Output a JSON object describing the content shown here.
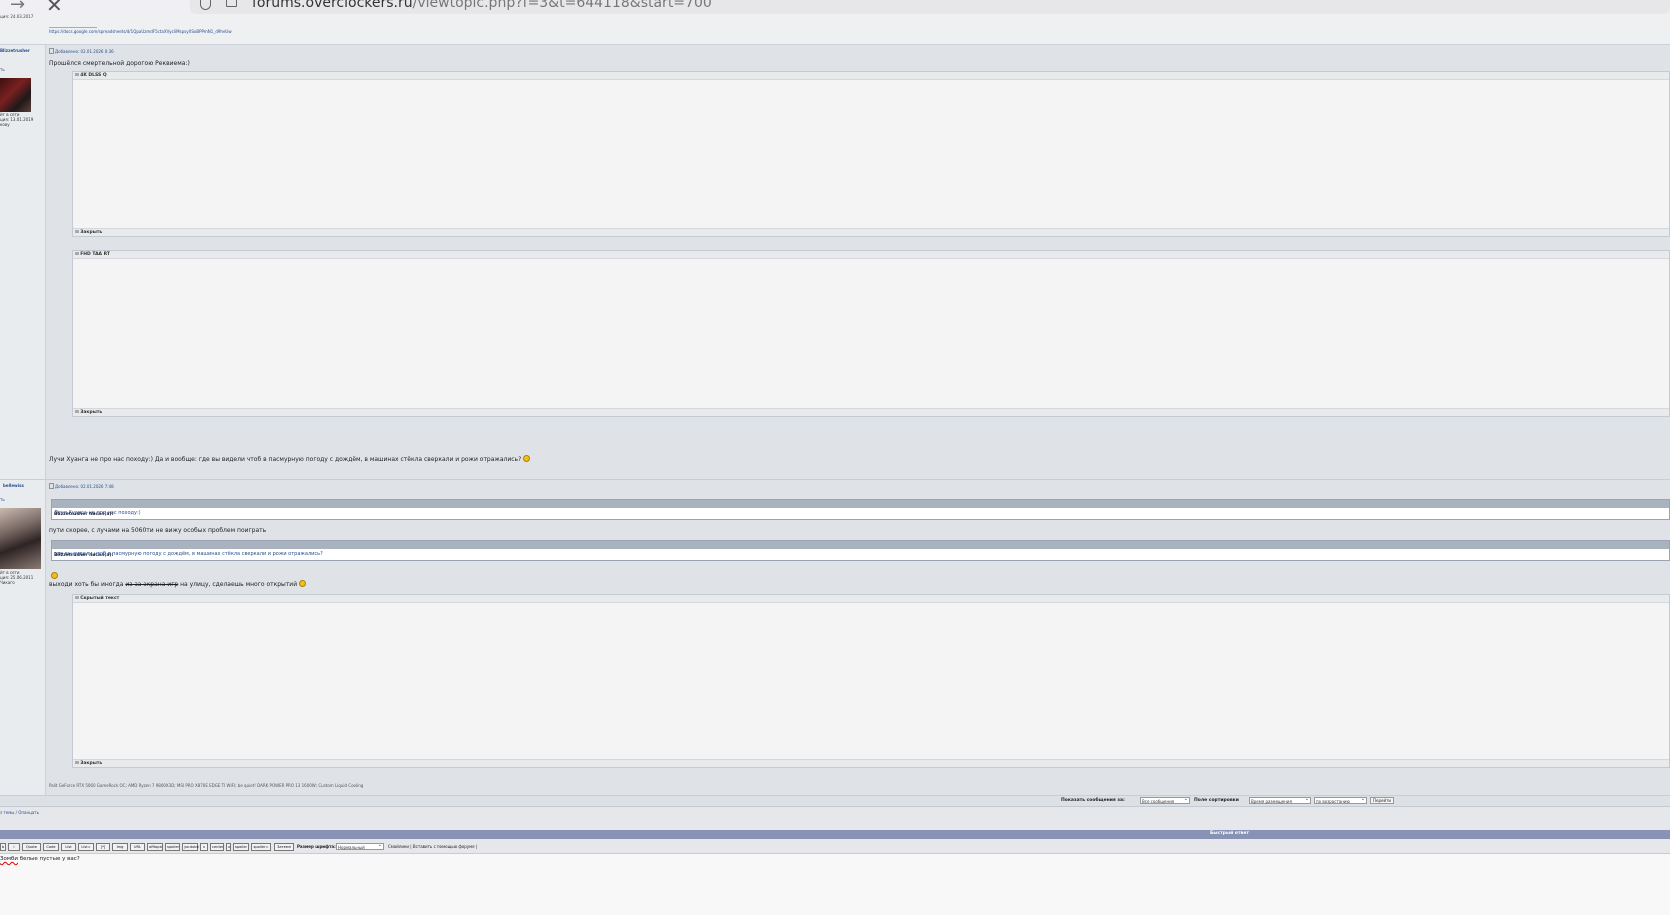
{
  "browser": {
    "url_domain": "forums.overclockers.ru",
    "url_path": "/viewtopic.php?f=3&t=644118&start=700"
  },
  "top": {
    "author_meta": "ция: 24.03.2017",
    "link": "https://docs.google.com/spreadsheets/d/1QpaUzmdF5ctaXVycIiMspsyXSoBPPmN1_d9heUw"
  },
  "posts": [
    {
      "author": "Blizzetrusher",
      "rank": "ть",
      "info": [
        "йт в сети",
        "ция: 13.01.2019",
        "кову"
      ],
      "date": "Добавлено: 02.01.2026 0:36",
      "intro": "Прошёлся смертельной дорогою Реквиема:)",
      "spoilers": [
        {
          "label": "4K DLSS Q",
          "close": "Закрыть"
        },
        {
          "label": "FHD TAA RT",
          "close": "Закрыть"
        }
      ],
      "text": "Лучи Хуанга не про нас походу:) Да и вообще: где вы видели чтоб в пасмурную погоду с дождём, в машинах стёкла сверкали и рожи отражались?"
    },
    {
      "author": "bellewiss",
      "rank": "ть",
      "info": [
        "йт в сети",
        "ция: 25.06.2011",
        "Чикаго"
      ],
      "date": "Добавлено: 02.01.2026 7:48",
      "quote1": {
        "head": "Blizzetrusher писал(а):",
        "body": "Лучи Хуанга не про нас походу:)"
      },
      "text1": "пути скорее, с лучами на 5060ти не вижу особых проблем поиграть",
      "quote2": {
        "head": "Blizzetrusher писал(а):",
        "body": "где вы видели чтоб в пасмурную погоду с дождём, в машинах стёкла сверкали и рожи отражались?"
      },
      "text2_a": "выходи хоть бы иногда",
      "text2_strike": "из-за экрана игр",
      "text2_b": "на улицу, сделаешь много открытий",
      "spoiler": {
        "label": "Скрытый текст",
        "close": "Закрыть"
      },
      "signature": "Palit GeForce RTX 5060 GameRock OC; AMD Ryzen 7 9800X3D; MSI PRO X870E EDGE TI WIFI; be quiet! DARK POWER PRO 13 1600W; Custom Liquid Cooling"
    }
  ],
  "display": {
    "show_label": "Показать сообщения за:",
    "show_value": "Все сообщения",
    "sort_label": "Поле сортировки",
    "sort_field": "Время размещения",
    "sort_dir": "по возрастанию",
    "go": "Перейти"
  },
  "actions": {
    "a": "з темы /",
    "b": "Опанцать"
  },
  "quick_reply": {
    "title": "Быстрый ответ",
    "buttons": [
      "b",
      "i",
      "Quote",
      "Code",
      "List",
      "List=",
      "[*]",
      "Img",
      "URL",
      "offtopic",
      "spoiler",
      "youtube",
      "s",
      "center",
      "x",
      "spoiler",
      "spoiler=",
      "Затемн"
    ],
    "font_size_label": "Размер шрифта:",
    "font_size_value": "Нормальный",
    "link": "Смайлики | Вставить с помощью форуме |",
    "reply_word": "Зомби",
    "reply_rest": "белые пустые у вас?"
  },
  "colors": {
    "link": "#2a4e8c",
    "quick_reply_bar": "#8792b5",
    "post_bg": "#dfe3e8"
  }
}
